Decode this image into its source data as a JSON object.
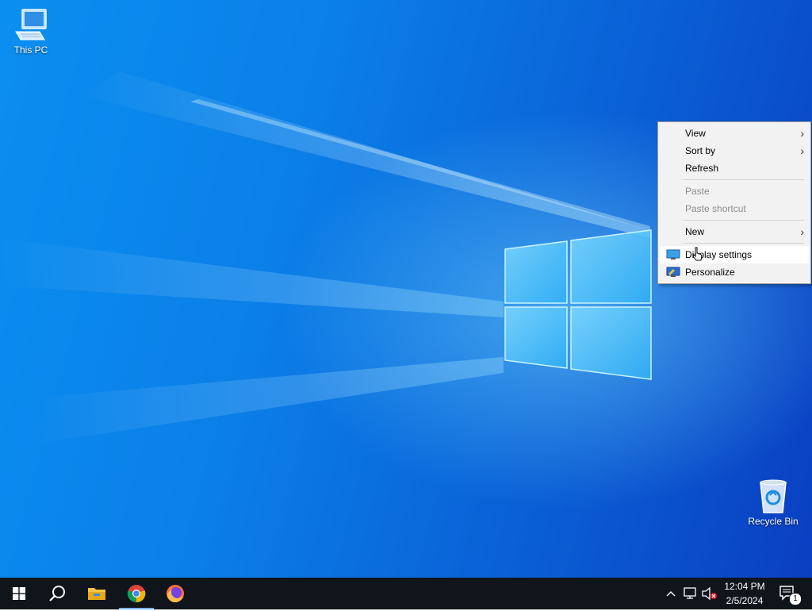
{
  "desktop": {
    "icons": [
      {
        "label": "This PC",
        "icon": "this-pc-icon"
      },
      {
        "label": "Recycle Bin",
        "icon": "recycle-bin-icon"
      }
    ]
  },
  "context_menu": {
    "items": [
      {
        "label": "View",
        "has_submenu": true,
        "enabled": true
      },
      {
        "label": "Sort by",
        "has_submenu": true,
        "enabled": true
      },
      {
        "label": "Refresh",
        "has_submenu": false,
        "enabled": true
      },
      {
        "label": "Paste",
        "has_submenu": false,
        "enabled": false
      },
      {
        "label": "Paste shortcut",
        "has_submenu": false,
        "enabled": false
      },
      {
        "label": "New",
        "has_submenu": true,
        "enabled": true
      },
      {
        "label": "Display settings",
        "has_submenu": false,
        "enabled": true,
        "icon": "display-settings-icon",
        "hovered": true
      },
      {
        "label": "Personalize",
        "has_submenu": false,
        "enabled": true,
        "icon": "personalize-icon"
      }
    ]
  },
  "taskbar": {
    "apps": [
      {
        "name": "start",
        "icon": "windows-start-icon"
      },
      {
        "name": "search",
        "icon": "search-icon"
      },
      {
        "name": "file-explorer",
        "icon": "file-explorer-icon"
      },
      {
        "name": "chrome",
        "icon": "chrome-icon",
        "active": true
      },
      {
        "name": "firefox",
        "icon": "firefox-icon"
      }
    ],
    "tray": {
      "time": "12:04 PM",
      "date": "2/5/2024",
      "notification_count": "1"
    }
  },
  "colors": {
    "taskbar": "#10151c",
    "menu_bg": "#f2f2f2",
    "desktop_accent": "#0a7fe8"
  }
}
